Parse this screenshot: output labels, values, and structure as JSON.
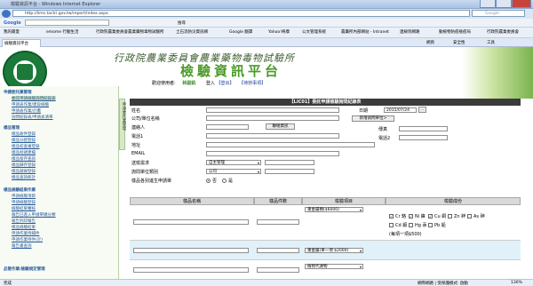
{
  "window": {
    "title": "檢驗資訊平台 - Windows Internet Explorer"
  },
  "address": {
    "url": "http://lims.tactri.gov.tw/report/Index.aspx",
    "search_placeholder": "Google"
  },
  "google_bar": {
    "label": "Google",
    "btn_search": "搜尋"
  },
  "favorites": [
    "我的最愛",
    "emome 行動生活",
    "行政院農業委員會農業藥物毒物試驗所",
    "土石流防災資訊網",
    "Google 翻譯",
    "Yahoo!奇摩",
    "公文管理系統",
    "農藥所內部網站 - Intranet",
    "連線到網路",
    "動植物防疫檢疫局",
    "行政院農業委員會"
  ],
  "favorites_right": [
    "網頁",
    "安全性",
    "工具"
  ],
  "tab": {
    "label": "檢驗資訊平台"
  },
  "header": {
    "org": "行政院農業委員會農業藥物毒物試驗所",
    "title": "檢驗資訊平台",
    "user_label": "歡迎使用者:",
    "user_name": "林副凱",
    "login": "登入",
    "logout": "【登出】",
    "todo": "【待辦事項】"
  },
  "sidebar": {
    "sections": [
      {
        "title": "申請委托業管理",
        "items": [
          "委託申請檢驗詢問紀錄表",
          "申請表作業/建段檢驗",
          "申請表作業/計畫",
          "詢問紀錄表/申請表清單"
        ]
      },
      {
        "title": "樣品管理",
        "items": [
          "樣品收件登錄",
          "樣品分配登錄",
          "樣品初查複登錄",
          "樣品批號建檔",
          "樣品留存查詢",
          "樣品歸存登錄",
          "樣品銷毀登錄",
          "樣品查詢統計"
        ]
      },
      {
        "title": "樣品檢驗結果作業",
        "items": [
          "申請檢驗項目",
          "申請檢驗登錄",
          "檢驗結果審核",
          "報告已進入申請單總分類",
          "報告列印報告",
          "樣品檢驗結果",
          "申請作業待補件",
          "申請作業待件(計)",
          "報告書查詢"
        ]
      },
      {
        "title": "品管作業/檢驗規定管理",
        "items": []
      }
    ],
    "selected": "委託申請檢驗詢問紀錄表"
  },
  "vtab": "申請委托業管理",
  "form": {
    "title": "【LIC01】委託申請檢驗詢問紀錄表",
    "labels": {
      "name": "姓名",
      "company": "公司/單位名稱",
      "contact": "連絡人",
      "phone1": "電話1",
      "address": "地址",
      "email": "EMAIL",
      "delivery": "送檢需求",
      "client_type": "詢問單位類別",
      "history": "樣品各別進生申請單",
      "date": "日期",
      "fax": "傳真",
      "phone2": "電話2"
    },
    "date_value": "2015/07/24",
    "btn_new_company": "新增詢問單位>",
    "btn_contact": "聯絡資訊",
    "delivery_value": "自主管理",
    "client_type_value": "公司",
    "radio_no": "否",
    "radio_yes": "是"
  },
  "grid": {
    "headers": [
      "樣品名稱",
      "樣品件數",
      "檢驗項目",
      "檢驗成份"
    ],
    "rows": [
      {
        "item": "重金屬類($6000)",
        "elements": [
          "Cr 鉻",
          "Ni 鎳",
          "Cu 銅",
          "Zn 鋅",
          "As 砷",
          "Cd 鎘",
          "Hg 汞",
          "Pb 鉛"
        ],
        "checked": [
          "Cr 鉻",
          "Ni 鎳",
          "Cu 銅"
        ],
        "note": "(每項一項$500)"
      },
      {
        "item": "重金屬(單一項 $2000)"
      },
      {
        "item": "植物代謝物"
      }
    ]
  },
  "status": {
    "left": "完成",
    "right": "網際網路 | 受保護模式: 啟動",
    "zoom": "130%"
  }
}
